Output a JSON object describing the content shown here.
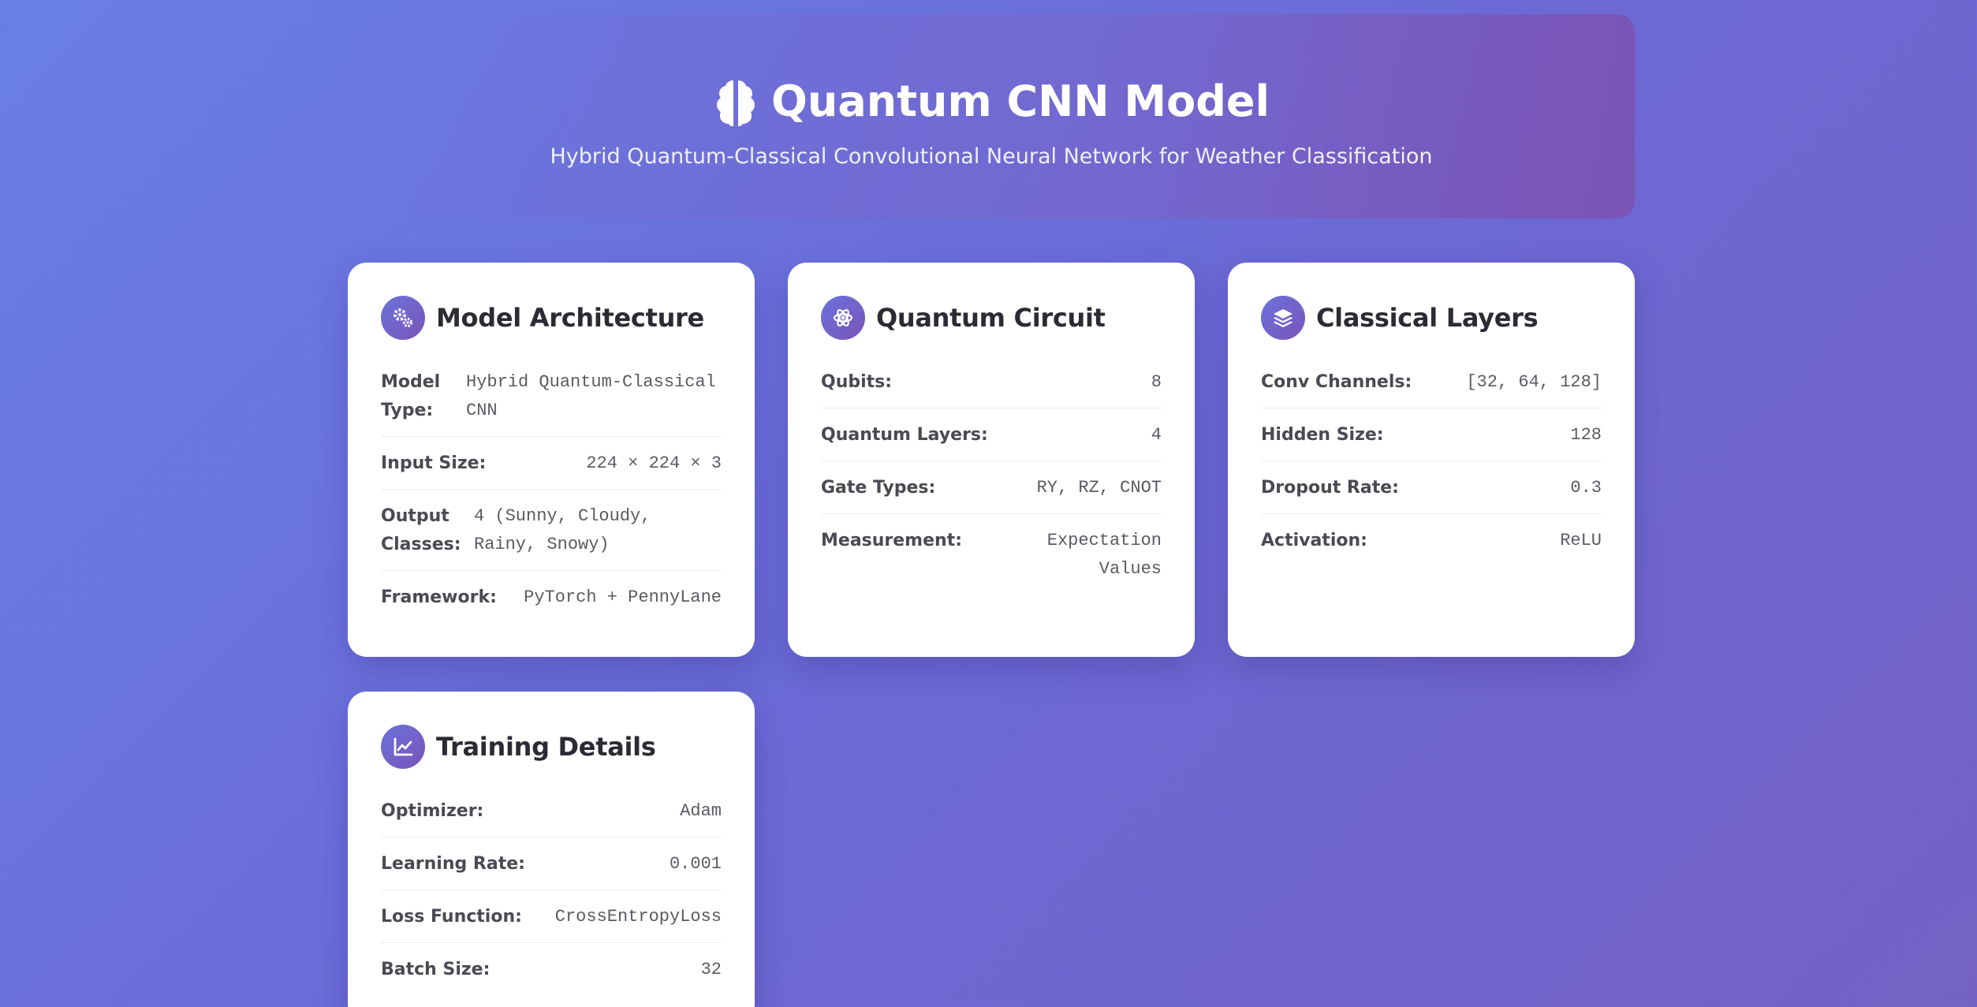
{
  "header": {
    "title": "Quantum CNN Model",
    "subtitle": "Hybrid Quantum-Classical Convolutional Neural Network for Weather Classification",
    "icon": "brain-icon"
  },
  "cards": {
    "architecture": {
      "title": "Model Architecture",
      "icon": "gears-icon",
      "rows": [
        {
          "label": "Model Type:",
          "value": "Hybrid Quantum-Classical CNN"
        },
        {
          "label": "Input Size:",
          "value": "224 × 224 × 3"
        },
        {
          "label": "Output Classes:",
          "value": "4 (Sunny, Cloudy, Rainy, Snowy)"
        },
        {
          "label": "Framework:",
          "value": "PyTorch + PennyLane"
        }
      ]
    },
    "quantum": {
      "title": "Quantum Circuit",
      "icon": "atom-icon",
      "rows": [
        {
          "label": "Qubits:",
          "value": "8"
        },
        {
          "label": "Quantum Layers:",
          "value": "4"
        },
        {
          "label": "Gate Types:",
          "value": "RY, RZ, CNOT"
        },
        {
          "label": "Measurement:",
          "value": "Expectation Values"
        }
      ]
    },
    "classical": {
      "title": "Classical Layers",
      "icon": "layers-icon",
      "rows": [
        {
          "label": "Conv Channels:",
          "value": "[32, 64, 128]"
        },
        {
          "label": "Hidden Size:",
          "value": "128"
        },
        {
          "label": "Dropout Rate:",
          "value": "0.3"
        },
        {
          "label": "Activation:",
          "value": "ReLU"
        }
      ]
    },
    "training": {
      "title": "Training Details",
      "icon": "chart-line-icon",
      "rows": [
        {
          "label": "Optimizer:",
          "value": "Adam"
        },
        {
          "label": "Learning Rate:",
          "value": "0.001"
        },
        {
          "label": "Loss Function:",
          "value": "CrossEntropyLoss"
        },
        {
          "label": "Batch Size:",
          "value": "32"
        }
      ]
    }
  },
  "colors": {
    "background_start": "#6a7fe8",
    "background_end": "#7461c4",
    "icon_gradient_start": "#6a72dc",
    "icon_gradient_end": "#7a55b8"
  }
}
